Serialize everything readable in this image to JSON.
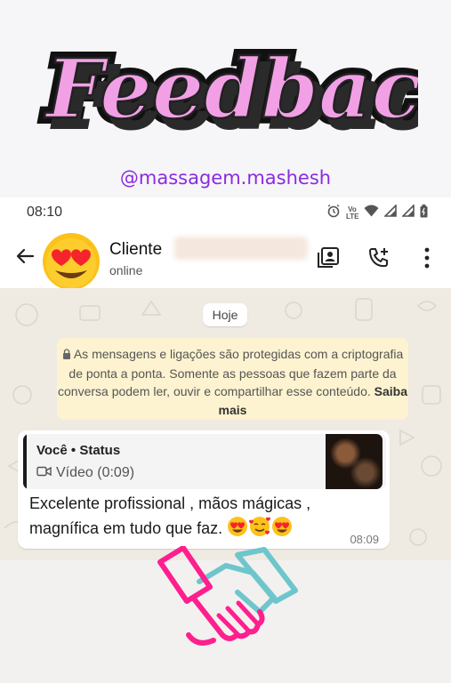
{
  "banner": {
    "title": "Feedback",
    "handle": "@massagem.mashesh"
  },
  "status_bar": {
    "time": "08:10",
    "network_label": "Vo LTE"
  },
  "chat_header": {
    "contact_name": "Cliente",
    "contact_status": "online",
    "icons": [
      "back-arrow-icon",
      "heart-eyes-emoji",
      "contact-card-icon",
      "add-call-icon",
      "more-vert-icon"
    ]
  },
  "chat": {
    "date_label": "Hoje",
    "encryption_notice": "As mensagens e ligações são protegidas com a criptografia de ponta a ponta. Somente as pessoas que fazem parte da conversa podem ler, ouvir e compartilhar esse conteúdo.",
    "learn_more": "Saiba mais",
    "message": {
      "reply_author": "Você • Status",
      "reply_media": "Vídeo (0:09)",
      "text_line1": "Excelente profissional , mãos mágicas ,",
      "text_line2": "magnífica em tudo que faz.",
      "emojis": [
        "heart-eyes",
        "smiling-face-with-hearts",
        "heart-eyes"
      ],
      "time": "08:09"
    }
  },
  "colors": {
    "title_pink": "#f2a0e6",
    "handle_purple": "#8a2be2",
    "chat_bg": "#efeae2",
    "notice_bg": "#fdf3d0",
    "handshake_pink": "#ff1f8e",
    "handshake_teal": "#6ec6cc"
  }
}
